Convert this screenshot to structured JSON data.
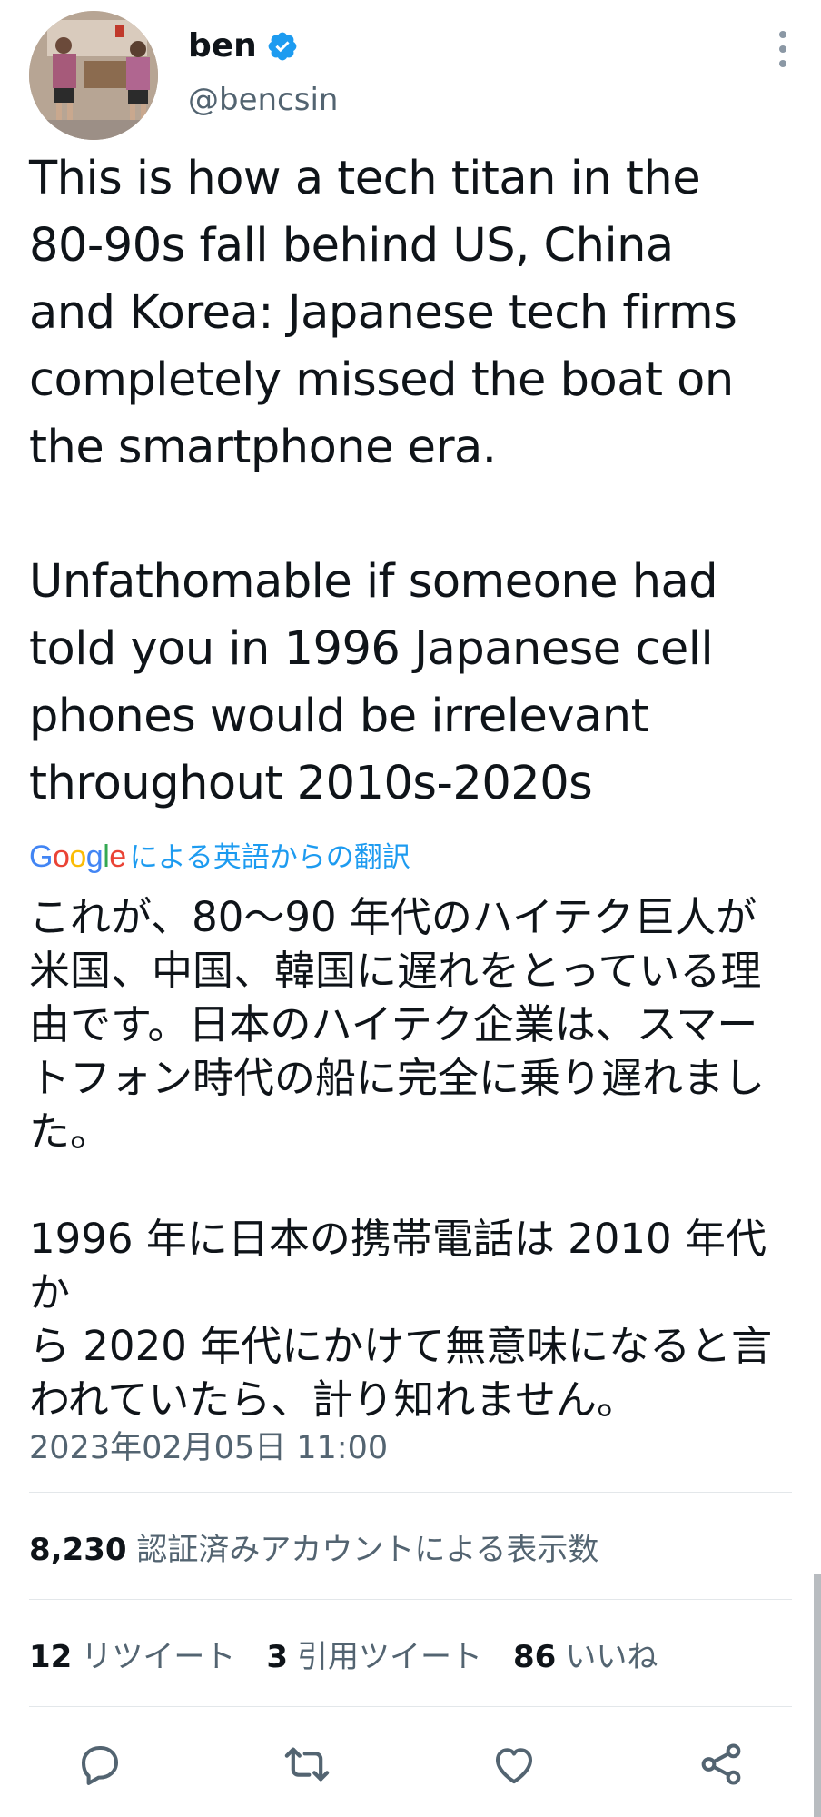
{
  "author": {
    "display_name": "ben",
    "handle": "@bencsin",
    "verified": true
  },
  "tweet": {
    "text": "This is how a tech titan in the\n80-90s fall behind US, China\nand Korea: Japanese tech firms\ncompletely missed the boat on\nthe smartphone era.\n\nUnfathomable if someone had\ntold you in 1996 Japanese cell\nphones would be irrelevant\nthroughout 2010s-2020s",
    "translation_logo": "Google",
    "translation_label": "による英語からの翻訳",
    "translated_text": "これが、80〜90 年代のハイテク巨人が\n米国、中国、韓国に遅れをとっている理\n由です。日本のハイテク企業は、スマー\nトフォン時代の船に完全に乗り遅れまし\nた。\n\n1996 年に日本の携帯電話は 2010 年代か\nら 2020 年代にかけて無意味になると言\nわれていたら、計り知れません。",
    "timestamp": "2023年02月05日 11:00"
  },
  "views": {
    "count": "8,230",
    "label": "認証済みアカウントによる表示数"
  },
  "stats": {
    "retweets": {
      "count": "12",
      "label": "リツイート"
    },
    "quotes": {
      "count": "3",
      "label": "引用ツイート"
    },
    "likes": {
      "count": "86",
      "label": "いいね"
    }
  },
  "colors": {
    "accent": "#1d9bf0",
    "secondary_text": "#536471",
    "primary_text": "#0f1419",
    "icon": "#536471"
  },
  "icons": {
    "verified": "verified-badge-icon",
    "more": "more-vertical-icon",
    "reply": "reply-icon",
    "retweet": "retweet-icon",
    "like": "heart-icon",
    "share": "share-icon"
  }
}
